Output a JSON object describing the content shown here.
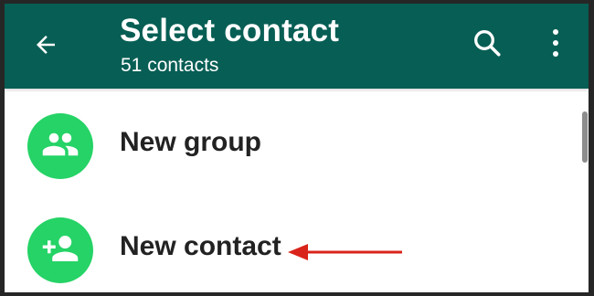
{
  "header": {
    "title": "Select contact",
    "subtitle": "51 contacts",
    "back_icon": "arrow-back-icon",
    "search_icon": "search-icon",
    "more_icon": "more-vert-icon"
  },
  "list": {
    "items": [
      {
        "label": "New group",
        "icon": "group-icon"
      },
      {
        "label": "New contact",
        "icon": "person-add-icon"
      }
    ]
  },
  "colors": {
    "appbar": "#075e54",
    "accent_green": "#25d366",
    "annotation_arrow": "#d9241b"
  }
}
